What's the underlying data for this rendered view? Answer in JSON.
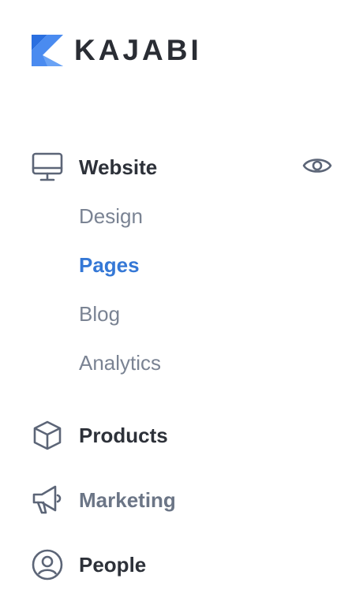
{
  "brand": {
    "name": "KAJABI",
    "accent": "#4a8bf0"
  },
  "nav": {
    "website": {
      "label": "Website",
      "icon": "monitor-icon",
      "preview_icon": "eye-icon"
    },
    "website_sub": [
      "Design",
      "Pages",
      "Blog",
      "Analytics"
    ],
    "website_active": "Pages",
    "products": {
      "label": "Products",
      "icon": "cube-icon"
    },
    "marketing": {
      "label": "Marketing",
      "icon": "megaphone-icon"
    },
    "people": {
      "label": "People",
      "icon": "user-circle-icon"
    }
  },
  "colors": {
    "text_dark": "#2d3139",
    "text_muted": "#7a8393",
    "active": "#3578d6"
  }
}
